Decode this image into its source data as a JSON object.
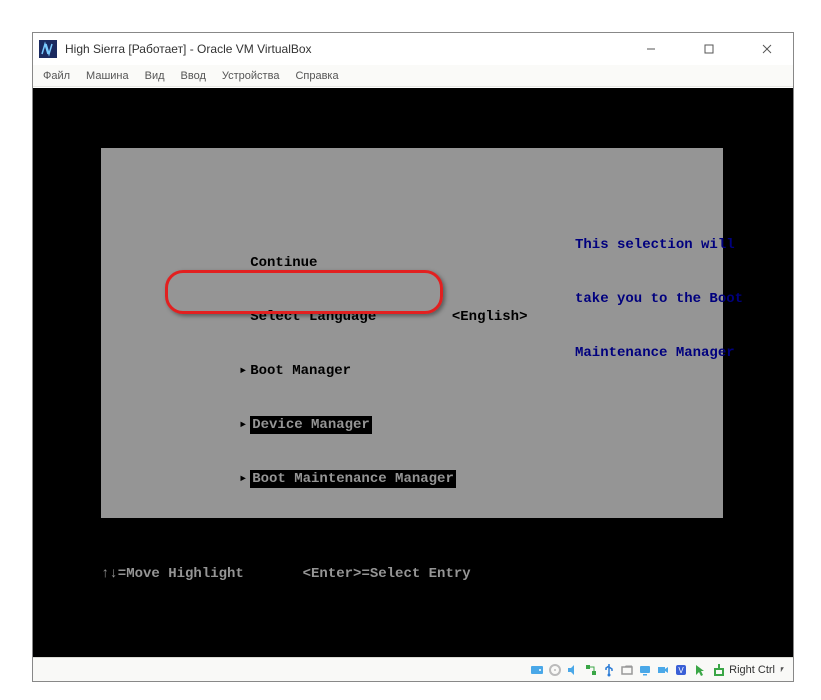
{
  "window": {
    "title": "High Sierra [Работает] - Oracle VM VirtualBox",
    "min_tooltip": "Minimize",
    "max_tooltip": "Maximize",
    "close_tooltip": "Close"
  },
  "menu": {
    "file": "Файл",
    "machine": "Машина",
    "view": "Вид",
    "input": "Ввод",
    "devices": "Устройства",
    "help": "Справка"
  },
  "uefi": {
    "continue": "Continue",
    "select_language": "Select Language",
    "language_value": "<English>",
    "boot_manager": "Boot Manager",
    "device_manager": "Device Manager",
    "boot_maintenance_manager": "Boot Maintenance Manager",
    "help_line1": "This selection will",
    "help_line2": "take you to the Boot",
    "help_line3": "Maintenance Manager",
    "footer": "↑↓=Move Highlight       <Enter>=Select Entry"
  },
  "status": {
    "hostkey": "Right Ctrl"
  },
  "colors": {
    "panel_bg": "#959595",
    "help_text": "#00007e",
    "annotation": "#e22020"
  }
}
